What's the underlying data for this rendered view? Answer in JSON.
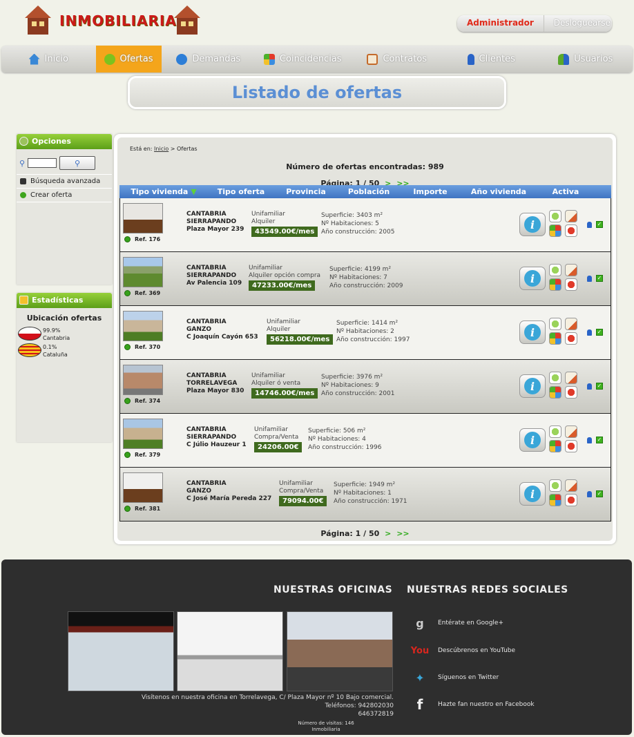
{
  "header": {
    "logo_text": "INMOBILIARIA",
    "admin_label": "Administrador",
    "logout_label": "Desloguearse"
  },
  "nav": [
    {
      "label": "Inicio",
      "icon": "home-icon",
      "color": "#3a88d6"
    },
    {
      "label": "Ofertas",
      "icon": "offers-icon",
      "color": "#7dc21e",
      "active": true
    },
    {
      "label": "Demandas",
      "icon": "demands-icon",
      "color": "#2d7ed7"
    },
    {
      "label": "Coincidencias",
      "icon": "matches-icon",
      "color": "#e2a02a"
    },
    {
      "label": "Contratos",
      "icon": "contracts-icon",
      "color": "#d95b2a"
    },
    {
      "label": "Clientes",
      "icon": "clients-icon",
      "color": "#2a64c7"
    },
    {
      "label": "Usuarios",
      "icon": "users-icon",
      "color": "#5aa82a"
    }
  ],
  "page_title": "Listado de ofertas",
  "sidebar": {
    "options_title": "Opciones",
    "advanced_search": "Búsqueda avanzada",
    "create_offer": "Crear oferta",
    "stats_title": "Estadísticas",
    "stats_subtitle": "Ubicación ofertas",
    "stats": [
      {
        "pct": "99.9%",
        "region": "Cantabria",
        "flag": "cantabria-flag-icon"
      },
      {
        "pct": "0.1%",
        "region": "Cataluña",
        "flag": "catalunya-flag-icon"
      }
    ]
  },
  "main": {
    "breadcrumb_prefix": "Está en:",
    "breadcrumb_link": "Inicio",
    "breadcrumb_sep": ">",
    "breadcrumb_current": "Ofertas",
    "count_text": "Número de ofertas encontradas: 989",
    "pager_text": "Página: 1 / 50",
    "pager_next": ">",
    "pager_last": ">>",
    "columns": [
      "Tipo vivienda",
      "Tipo oferta",
      "Provincia",
      "Población",
      "Importe",
      "Año vivienda",
      "Activa"
    ],
    "rows": [
      {
        "ref": "Ref. 176",
        "province": "CANTABRIA",
        "town": "SIERRAPANDO",
        "street": "Plaza Mayor 239",
        "kind": "Unifamiliar",
        "offer": "Alquiler",
        "price": "43549.00€/mes",
        "surface": "Superficie: 3403 m²",
        "rooms": "Nº Habitaciones: 5",
        "year": "Año construcción: 2005"
      },
      {
        "ref": "Ref. 369",
        "province": "CANTABRIA",
        "town": "SIERRAPANDO",
        "street": "Av Palencia 109",
        "kind": "Unifamiliar",
        "offer": "Alquiler opción compra",
        "price": "47233.00€/mes",
        "surface": "Superficie: 4199 m²",
        "rooms": "Nº Habitaciones: 7",
        "year": "Año construcción: 2009"
      },
      {
        "ref": "Ref. 370",
        "province": "CANTABRIA",
        "town": "GANZO",
        "street": "C Joaquín Cayón 653",
        "kind": "Unifamiliar",
        "offer": "Alquiler",
        "price": "56218.00€/mes",
        "surface": "Superficie: 1414 m²",
        "rooms": "Nº Habitaciones: 2",
        "year": "Año construcción: 1997"
      },
      {
        "ref": "Ref. 374",
        "province": "CANTABRIA",
        "town": "TORRELAVEGA",
        "street": "Plaza Mayor 830",
        "kind": "Unifamiliar",
        "offer": "Alquiler ó venta",
        "price": "14746.00€/mes",
        "surface": "Superficie: 3976 m²",
        "rooms": "Nº Habitaciones: 9",
        "year": "Año construcción: 2001"
      },
      {
        "ref": "Ref. 379",
        "province": "CANTABRIA",
        "town": "SIERRAPANDO",
        "street": "C Júlio Hauzeur 1",
        "kind": "Unifamiliar",
        "offer": "Compra/Venta",
        "price": "24206.00€",
        "surface": "Superficie: 506 m²",
        "rooms": "Nº Habitaciones: 4",
        "year": "Año construcción: 1996"
      },
      {
        "ref": "Ref. 381",
        "province": "CANTABRIA",
        "town": "GANZO",
        "street": "C José María Pereda 227",
        "kind": "Unifamiliar",
        "offer": "Compra/Venta",
        "price": "79094.00€",
        "surface": "Superficie: 1949 m²",
        "rooms": "Nº Habitaciones: 1",
        "year": "Año construcción: 1971"
      }
    ]
  },
  "footer": {
    "offices_title": "NUESTRAS OFICINAS",
    "social_title": "NUESTRAS REDES SOCIALES",
    "office_line1": "Visítenos en nuestra oficina en Torrelavega, C/ Plaza Mayor nº 10 Bajo comercial.",
    "office_line2": "Teléfonos: 942802030",
    "office_line3": "646372819",
    "visits": "Número de visitas: 146",
    "brand": "Inmobiliaria",
    "social": [
      {
        "label": "Entérate en Google+",
        "icon": "google-plus-icon"
      },
      {
        "label": "Descúbrenos en YouTube",
        "icon": "youtube-icon"
      },
      {
        "label": "Síguenos en Twitter",
        "icon": "twitter-icon"
      },
      {
        "label": "Hazte fan nuestro en Facebook",
        "icon": "facebook-icon"
      }
    ]
  }
}
